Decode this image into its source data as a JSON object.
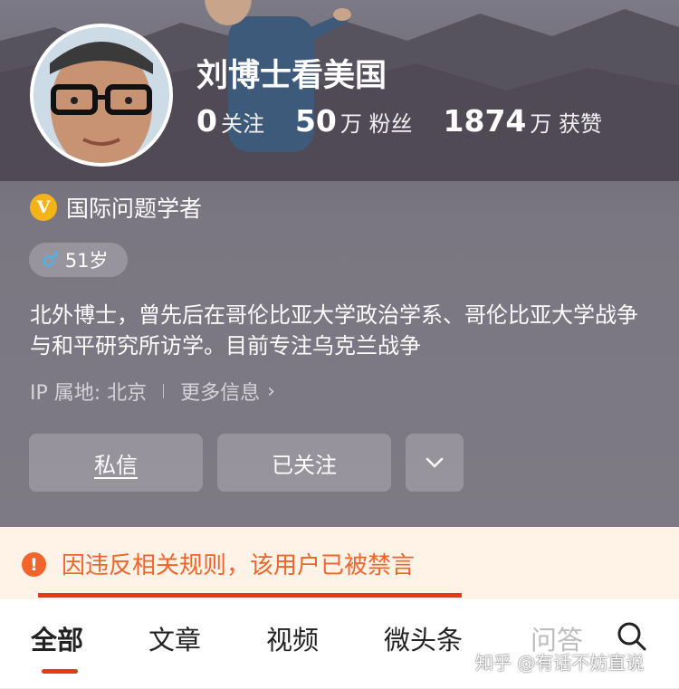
{
  "profile": {
    "username": "刘博士看美国",
    "stats": [
      {
        "value": "0",
        "label": "关注"
      },
      {
        "value": "50",
        "label": "万 粉丝"
      },
      {
        "value": "1874",
        "label": "万 获赞"
      }
    ],
    "verify": {
      "badge": "V",
      "title": "国际问题学者"
    },
    "age": {
      "gender_icon": "♂",
      "label": "51岁"
    },
    "bio": "北外博士，曾先后在哥伦比亚大学政治学系、哥伦比亚大学战争与和平研究所访学。目前专注乌克兰战争",
    "ip": {
      "label": "IP 属地: 北京",
      "more": "更多信息",
      "chevron": "›"
    },
    "buttons": {
      "message": "私信",
      "followed": "已关注",
      "more_chevron": "⌄"
    }
  },
  "ban_notice": {
    "icon": "!",
    "text": "因违反相关规则，该用户已被禁言"
  },
  "tabs": {
    "items": [
      "全部",
      "文章",
      "视频",
      "微头条",
      "问答"
    ],
    "active_index": 0
  },
  "watermark": "知乎 @有话不妨直说",
  "colors": {
    "accent": "#e63a12",
    "ban_text": "#f2642a",
    "verify_badge": "#f5b31a",
    "male_icon": "#46b4ee"
  }
}
